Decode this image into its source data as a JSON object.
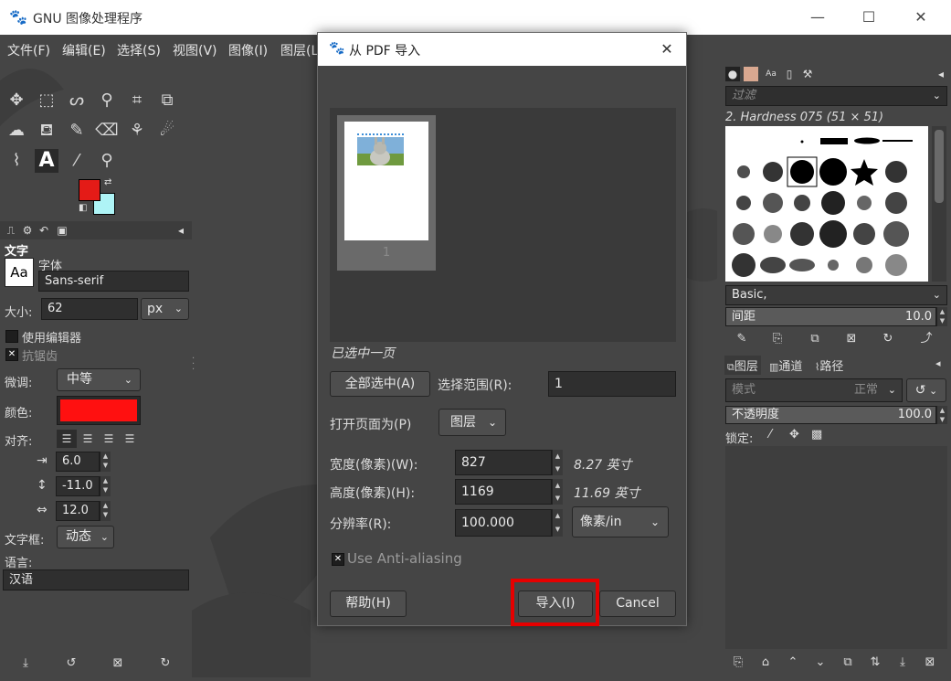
{
  "app": {
    "title": "GNU 图像处理程序",
    "window_controls": {
      "minimize": "—",
      "maximize": "☐",
      "close": "✕"
    }
  },
  "menu": [
    "文件(F)",
    "编辑(E)",
    "选择(S)",
    "视图(V)",
    "图像(I)",
    "图层(L)"
  ],
  "toolbox": {
    "tools": [
      {
        "name": "move-tool-icon",
        "glyph": "✥"
      },
      {
        "name": "rect-select-icon",
        "glyph": "⬚"
      },
      {
        "name": "lasso-icon",
        "glyph": "ᔕ"
      },
      {
        "name": "fuzzy-select-icon",
        "glyph": "⚲"
      },
      {
        "name": "crop-icon",
        "glyph": "⌗"
      },
      {
        "name": "transform-icon",
        "glyph": "⧉"
      },
      {
        "name": "warp-icon",
        "glyph": "☁"
      },
      {
        "name": "bucket-fill-icon",
        "glyph": "⛾"
      },
      {
        "name": "paintbrush-icon",
        "glyph": "✎"
      },
      {
        "name": "eraser-icon",
        "glyph": "⌫"
      },
      {
        "name": "clone-icon",
        "glyph": "⚘"
      },
      {
        "name": "smudge-icon",
        "glyph": "☄"
      },
      {
        "name": "paths-icon",
        "glyph": "⌇"
      },
      {
        "name": "text-tool-icon",
        "glyph": "A"
      },
      {
        "name": "color-picker-icon",
        "glyph": "⁄"
      },
      {
        "name": "zoom-icon",
        "glyph": "⚲"
      }
    ],
    "fg_color": "#e41b17",
    "bg_color": "#aef4f6"
  },
  "tool_options": {
    "heading": "文字",
    "font_label": "字体",
    "font_icon_text": "Aa",
    "font_value": "Sans-serif",
    "size_label": "大小:",
    "size_value": "62",
    "size_unit": "px",
    "use_editor": "使用编辑器",
    "antialias": "抗锯齿",
    "hinting_label": "微调:",
    "hinting_value": "中等",
    "color_label": "颜色:",
    "text_color": "#ff1010",
    "justify_label": "对齐:",
    "indent": "6.0",
    "line_spacing": "-11.0",
    "letter_spacing": "12.0",
    "box_label": "文字框:",
    "box_value": "动态",
    "language_label": "语言:",
    "language_value": "汉语"
  },
  "brushes": {
    "filter_placeholder": "过滤",
    "selected_brush": "2. Hardness 075 (51 × 51)",
    "preset": "Basic,",
    "spacing_label": "间距",
    "spacing_value": "10.0"
  },
  "layers": {
    "tabs": [
      "图层",
      "通道",
      "路径"
    ],
    "mode_label": "模式",
    "mode_value": "正常",
    "opacity_label": "不透明度",
    "opacity_value": "100.0",
    "lock_label": "锁定:"
  },
  "dialog": {
    "title": "从 PDF 导入",
    "page_number": "1",
    "selection_status": "已选中一页",
    "select_all": "全部选中(A)",
    "range_label": "选择范围(R):",
    "range_value": "1",
    "open_as_label": "打开页面为(P)",
    "open_as_value": "图层",
    "width_label": "宽度(像素)(W):",
    "width_value": "827",
    "width_inches": "8.27 英寸",
    "height_label": "高度(像素)(H):",
    "height_value": "1169",
    "height_inches": "11.69 英寸",
    "resolution_label": "分辨率(R):",
    "resolution_value": "100.000",
    "resolution_unit": "像素/in",
    "antialias_label": "Use Anti-aliasing",
    "help_button": "帮助(H)",
    "import_button": "导入(I)",
    "cancel_button": "Cancel",
    "highlight_color": "#e60000"
  }
}
